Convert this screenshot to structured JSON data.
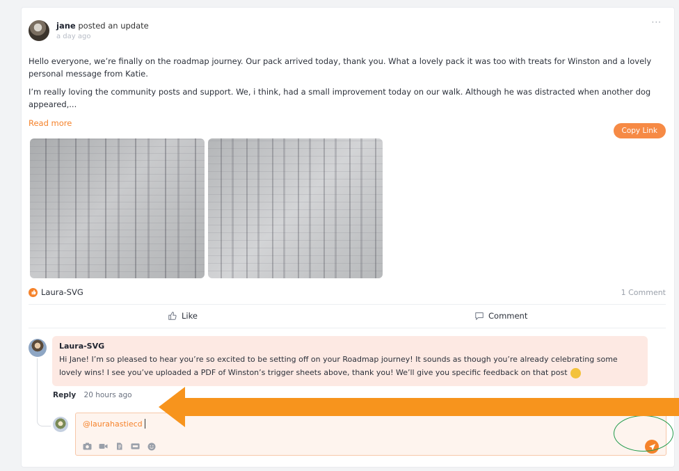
{
  "post": {
    "author": "jane",
    "action_text": " posted an update",
    "time": "a day ago",
    "menu": "···",
    "paragraph1": "Hello everyone, we’re finally on the roadmap journey. Our pack arrived today, thank you. What a lovely pack it was too with treats for Winston and a lovely personal message from Katie.",
    "paragraph2": "I’m really loving the community posts and support. We, i think, had a small improvement today on our walk. Although he was distracted when another dog appeared,...",
    "read_more": "Read more",
    "copy_link": "Copy Link",
    "images": [
      "photo-1",
      "photo-2"
    ]
  },
  "reactions": {
    "reactor": "Laura-SVG",
    "comment_count": "1 Comment",
    "like_label": "Like",
    "comment_label": "Comment"
  },
  "comment": {
    "author": "Laura-SVG",
    "text": "Hi Jane! I’m so pleased to hear you’re so excited to be setting off on your Roadmap journey! It sounds as though you’re already celebrating some lovely wins! I see you’ve uploaded a PDF of Winston’s trigger sheets above, thank you! We’ll give you specific feedback on that post",
    "reply_label": "Reply",
    "time": "20 hours ago"
  },
  "composer": {
    "value": "@laurahastiecd",
    "tools": [
      "camera-icon",
      "video-icon",
      "document-icon",
      "gif-icon",
      "emoji-icon"
    ]
  },
  "colors": {
    "accent": "#f5822a",
    "comment_bg": "#fde9e3",
    "highlight_ring": "#1f9a4a",
    "arrow": "#f7941d"
  }
}
